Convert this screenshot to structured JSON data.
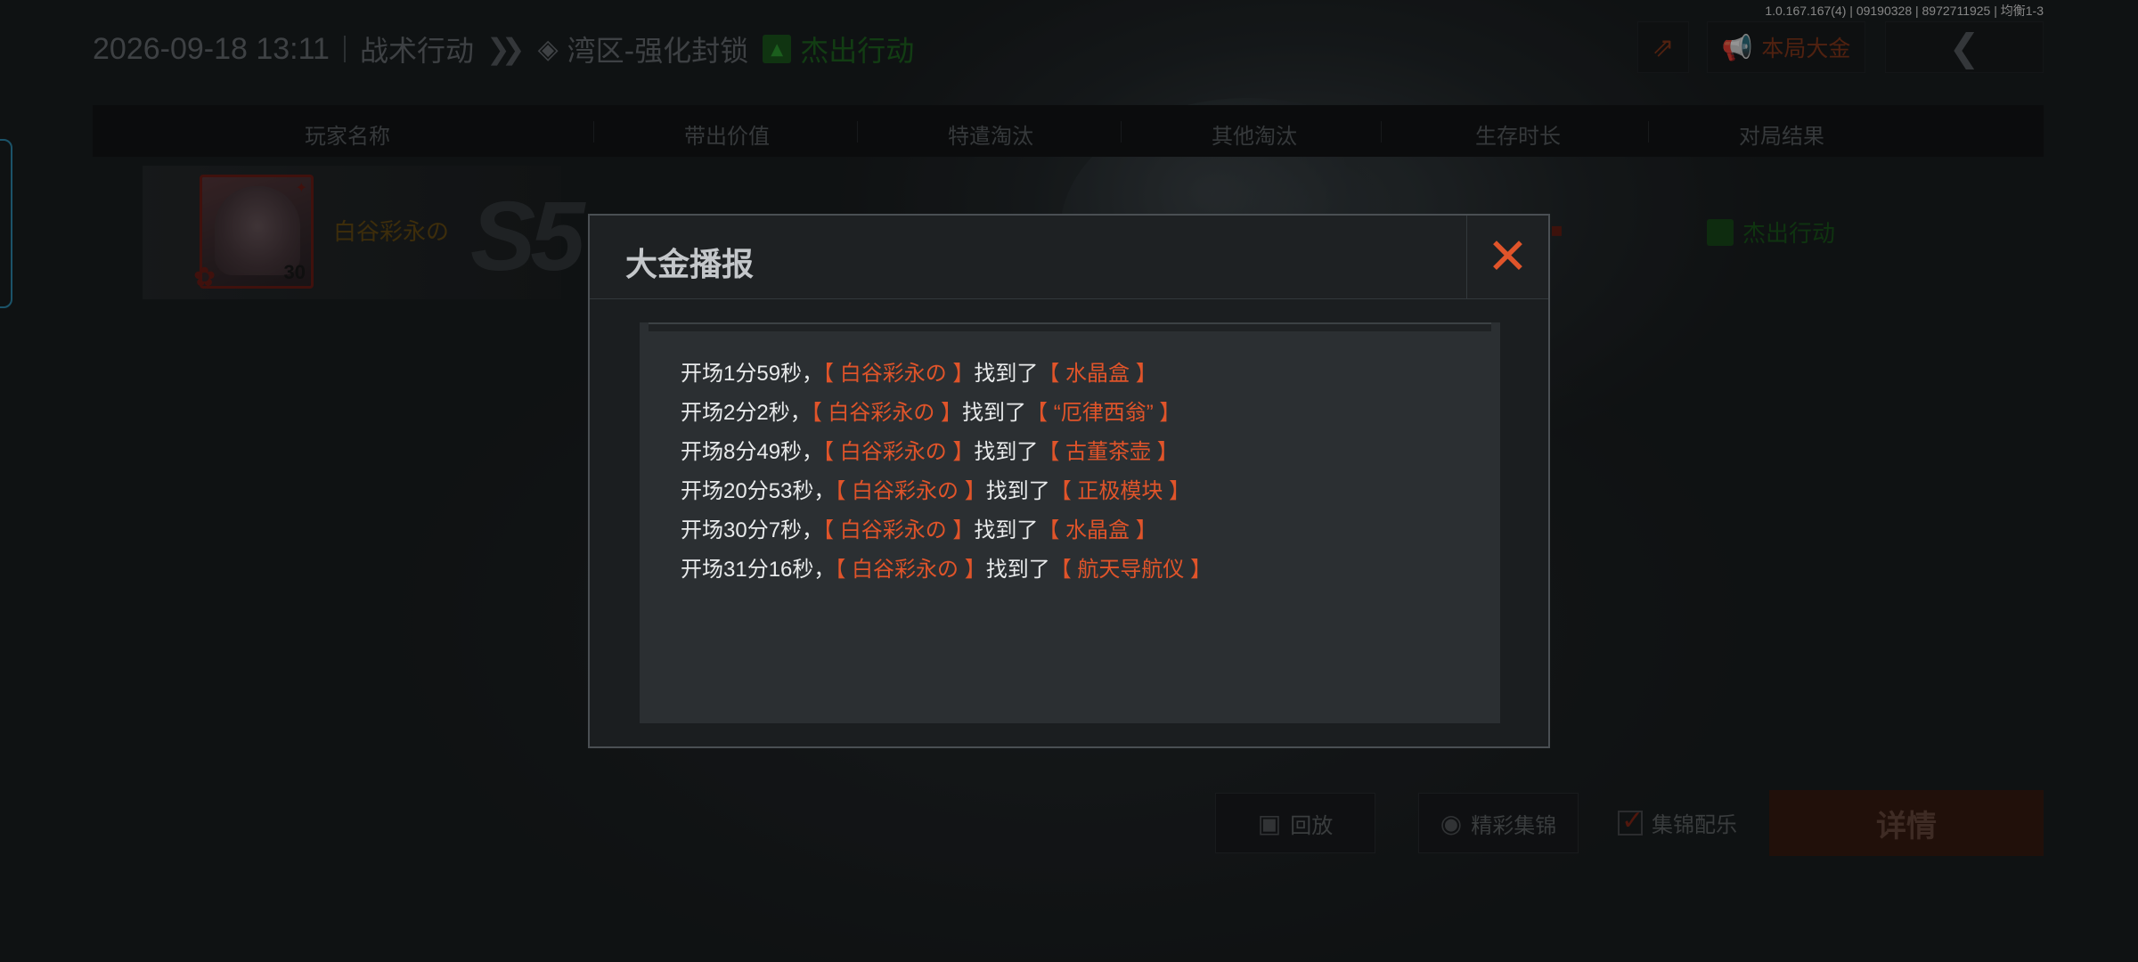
{
  "version_text": "1.0.167.167(4) | 09190328 | 8972711925 | 均衡1-3",
  "header": {
    "datetime": "2026-09-18 13:11",
    "mode": "战术行动",
    "map": "湾区-强化封锁",
    "result": "杰出行动",
    "jackpot_label": "本局大金"
  },
  "columns": [
    "玩家名称",
    "带出价值",
    "特遣淘汰",
    "其他淘汰",
    "生存时长",
    "对局结果"
  ],
  "player": {
    "name": "白谷彩永の",
    "level": "30",
    "season": "S5",
    "result": "杰出行动"
  },
  "bottom": {
    "replay_label": "回放",
    "highlight_label": "精彩集锦",
    "music_label": "集锦配乐",
    "detail_label": "详情"
  },
  "modal": {
    "title": "大金播报",
    "messages": [
      {
        "time": "开场1分59秒，",
        "player": "【 白谷彩永の 】",
        "verb": "找到了",
        "item": "【 水晶盒 】"
      },
      {
        "time": "开场2分2秒，",
        "player": "【 白谷彩永の 】",
        "verb": "找到了",
        "item": "【 “厄律西翁” 】"
      },
      {
        "time": "开场8分49秒，",
        "player": "【 白谷彩永の 】",
        "verb": "找到了",
        "item": "【 古董茶壶 】"
      },
      {
        "time": "开场20分53秒，",
        "player": "【 白谷彩永の 】",
        "verb": "找到了",
        "item": "【 正极模块 】"
      },
      {
        "time": "开场30分7秒，",
        "player": "【 白谷彩永の 】",
        "verb": "找到了",
        "item": "【 水晶盒 】"
      },
      {
        "time": "开场31分16秒，",
        "player": "【 白谷彩永の 】",
        "verb": "找到了",
        "item": "【 航天导航仪 】"
      }
    ]
  },
  "icons": {
    "share": "share-icon",
    "jackpot": "megaphone-icon",
    "back": "back-arrow-icon",
    "close": "close-icon",
    "replay": "film-icon",
    "highlight": "camera-icon"
  },
  "colors": {
    "accent": "#e0542a",
    "success": "#2fa233",
    "player_gold": "#6a4f14"
  }
}
